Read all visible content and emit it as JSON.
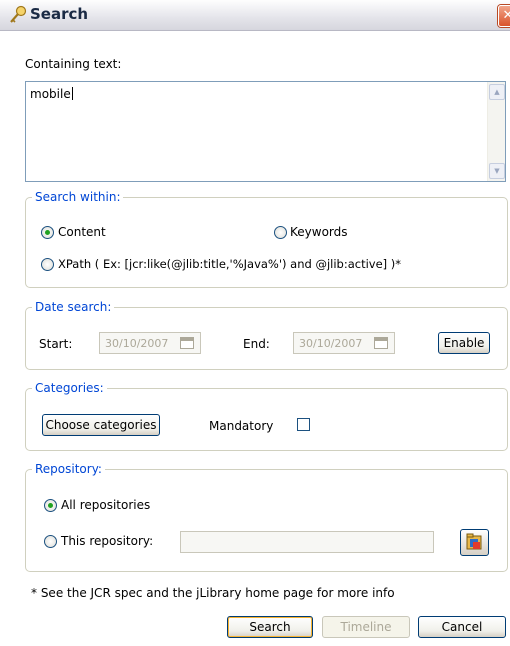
{
  "window": {
    "title": "Search",
    "close_glyph": "✕",
    "title_icon": "key-magnifier-icon"
  },
  "containing_text": {
    "label": "Containing text:",
    "value": "mobile"
  },
  "search_within": {
    "legend": "Search within:",
    "content_label": "Content",
    "keywords_label": "Keywords",
    "xpath_label": "XPath ( Ex: [jcr:like(@jlib:title,'%Java%') and @jlib:active] )*",
    "selected": "Content"
  },
  "date_search": {
    "legend": "Date search:",
    "start_label": "Start:",
    "start_value": "30/10/2007",
    "end_label": "End:",
    "end_value": "30/10/2007",
    "enable_label": "Enable"
  },
  "categories": {
    "legend": "Categories:",
    "choose_label": "Choose categories",
    "mandatory_label": "Mandatory",
    "mandatory_checked": false
  },
  "repository": {
    "legend": "Repository:",
    "all_label": "All repositories",
    "this_label": "This repository:",
    "selected": "All repositories",
    "this_value": ""
  },
  "footnote": "* See the JCR spec and the jLibrary home page for more info",
  "buttons": {
    "search": "Search",
    "timeline": "Timeline",
    "cancel": "Cancel"
  },
  "colors": {
    "legend": "#0046d5",
    "radio_dot": "#21a121",
    "border": "#7f9db9"
  }
}
